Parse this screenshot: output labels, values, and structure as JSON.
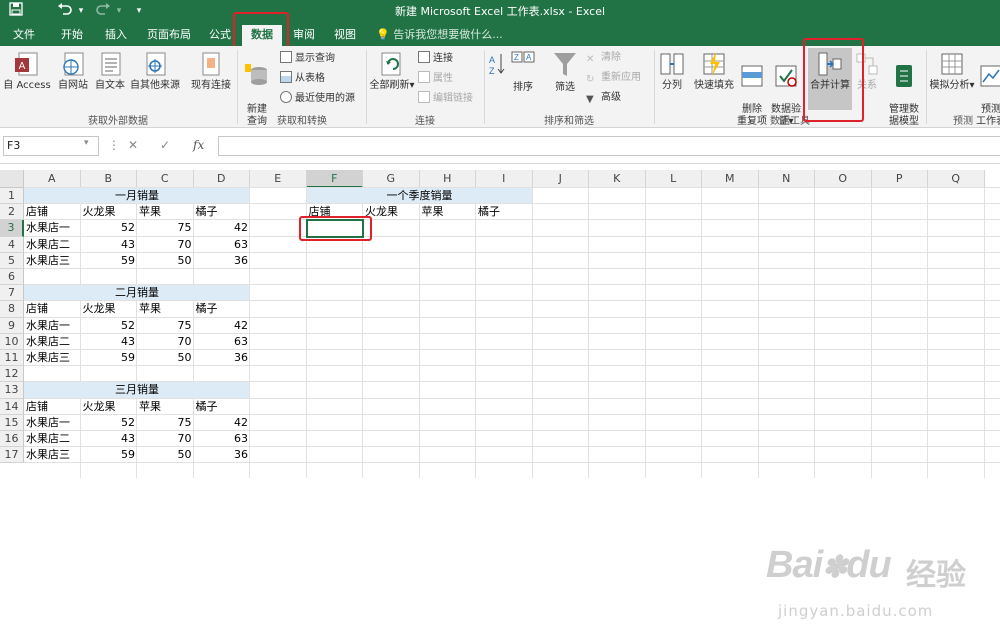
{
  "window": {
    "title": "新建 Microsoft Excel 工作表.xlsx - Excel"
  },
  "quick_access": {
    "save_icon": "save-icon",
    "undo_icon": "undo-icon",
    "redo_icon": "redo-icon",
    "customize_icon": "customize-icon"
  },
  "tabs": [
    "文件",
    "开始",
    "插入",
    "页面布局",
    "公式",
    "数据",
    "审阅",
    "视图"
  ],
  "active_tab": "数据",
  "tell_me": "告诉我您想要做什么...",
  "ribbon": {
    "get_external": {
      "label": "获取外部数据",
      "buttons": [
        "自 Access",
        "自网站",
        "自文本",
        "自其他来源",
        "现有连接"
      ]
    },
    "get_transform": {
      "label": "获取和转换",
      "new_query": "新建\n查询",
      "items": [
        "显示查询",
        "从表格",
        "最近使用的源"
      ]
    },
    "connections": {
      "label": "连接",
      "refresh_all": "全部刷新",
      "items": [
        "连接",
        "属性",
        "编辑链接"
      ]
    },
    "sort_filter": {
      "label": "排序和筛选",
      "sort": "排序",
      "filter": "筛选",
      "items": [
        "清除",
        "重新应用",
        "高级"
      ]
    },
    "data_tools": {
      "label": "数据工具",
      "buttons": [
        "分列",
        "快速填充",
        "删除\n重复项",
        "数据验\n证",
        "合并计算",
        "关系",
        "管理数\n据模型"
      ]
    },
    "forecast": {
      "label": "预测",
      "buttons": [
        "模拟分析",
        "预测\n工作表"
      ]
    }
  },
  "formula_bar": {
    "name_box": "F3",
    "formula": ""
  },
  "columns": [
    "A",
    "B",
    "C",
    "D",
    "E",
    "F",
    "G",
    "H",
    "I",
    "J",
    "K",
    "L",
    "M",
    "N",
    "O",
    "P",
    "Q"
  ],
  "rows": [
    "1",
    "2",
    "3",
    "4",
    "5",
    "6",
    "7",
    "8",
    "9",
    "10",
    "11",
    "12",
    "13",
    "14",
    "15",
    "16",
    "17"
  ],
  "selected_cell": {
    "column": "F",
    "row": "3"
  },
  "sheet": {
    "block1": {
      "title": "一月销量",
      "headers": [
        "店铺",
        "火龙果",
        "苹果",
        "橘子"
      ],
      "rows": [
        [
          "水果店一",
          "52",
          "75",
          "42"
        ],
        [
          "水果店二",
          "43",
          "70",
          "63"
        ],
        [
          "水果店三",
          "59",
          "50",
          "36"
        ]
      ]
    },
    "block2": {
      "title": "二月销量",
      "headers": [
        "店铺",
        "火龙果",
        "苹果",
        "橘子"
      ],
      "rows": [
        [
          "水果店一",
          "52",
          "75",
          "42"
        ],
        [
          "水果店二",
          "43",
          "70",
          "63"
        ],
        [
          "水果店三",
          "59",
          "50",
          "36"
        ]
      ]
    },
    "block3": {
      "title": "三月销量",
      "headers": [
        "店铺",
        "火龙果",
        "苹果",
        "橘子"
      ],
      "rows": [
        [
          "水果店一",
          "52",
          "75",
          "42"
        ],
        [
          "水果店二",
          "43",
          "70",
          "63"
        ],
        [
          "水果店三",
          "59",
          "50",
          "36"
        ]
      ]
    },
    "summary": {
      "title": "一个季度销量",
      "headers": [
        "店铺",
        "火龙果",
        "苹果",
        "橘子"
      ]
    }
  },
  "watermark": {
    "line1": "Bai",
    "paw": "du",
    "cn": "经验",
    "url": "jingyan.baidu.com"
  },
  "colors": {
    "excel_green": "#217346",
    "highlight_red": "#e0202a",
    "title_fill": "#ddebf7"
  }
}
